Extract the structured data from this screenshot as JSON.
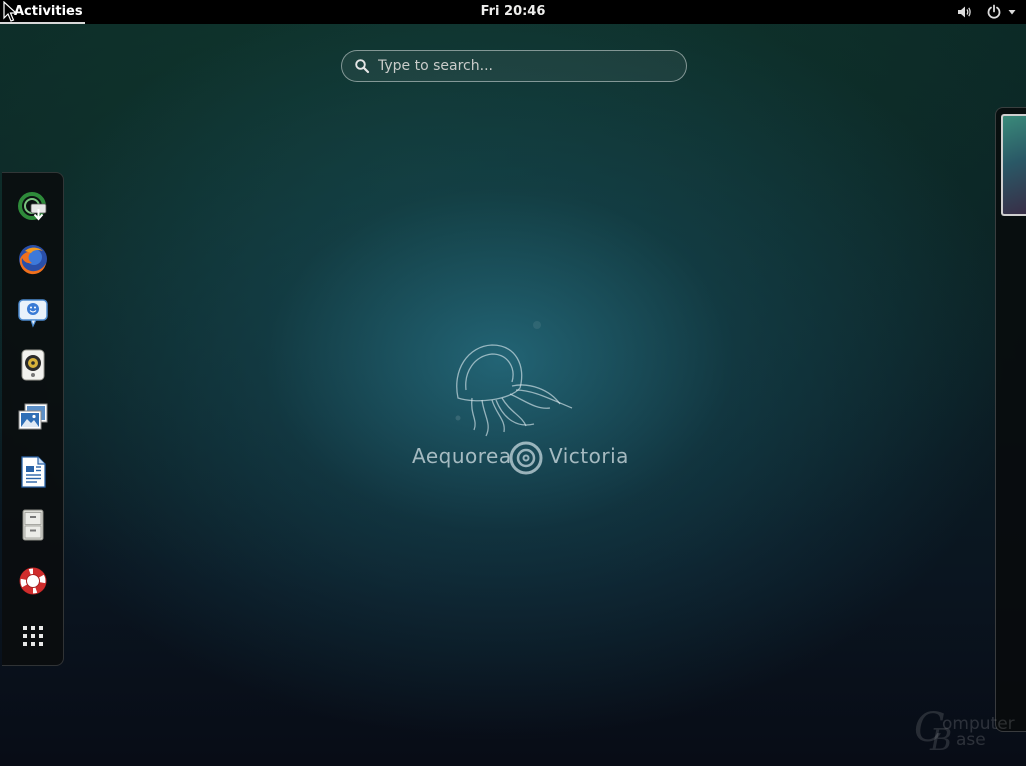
{
  "topbar": {
    "activities_label": "Activities",
    "clock": "Fri 20:46",
    "icons": [
      "volume-icon",
      "power-icon",
      "chevron-down-icon"
    ]
  },
  "search": {
    "placeholder": "Type to search..."
  },
  "dash": {
    "items": [
      {
        "name": "software-update-icon"
      },
      {
        "name": "firefox-icon"
      },
      {
        "name": "empathy-chat-icon"
      },
      {
        "name": "rhythmbox-icon"
      },
      {
        "name": "shotwell-photos-icon"
      },
      {
        "name": "libreoffice-writer-icon"
      },
      {
        "name": "files-cabinet-icon"
      },
      {
        "name": "help-lifebuoy-icon"
      },
      {
        "name": "show-applications-icon"
      }
    ]
  },
  "wallpaper": {
    "logo_left": "Aequorea",
    "logo_right": "Victoria"
  },
  "watermark": {
    "line1": "omputer",
    "line2": "ase"
  },
  "colors": {
    "topbar_bg": "#000000",
    "text": "#eeeeec",
    "dash_bg": "#0a0c0e"
  }
}
